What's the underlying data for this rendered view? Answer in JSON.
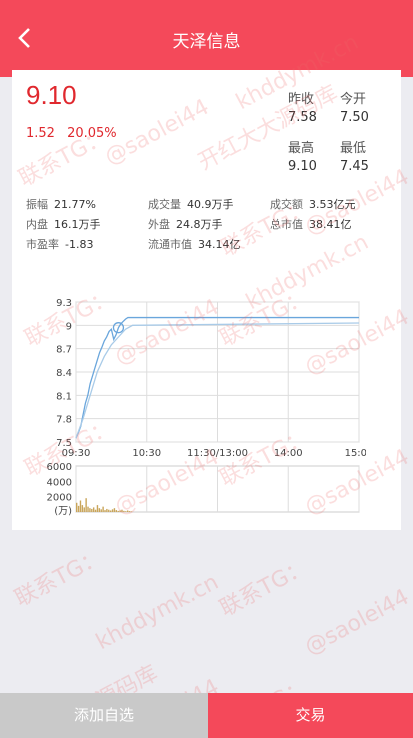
{
  "header": {
    "title": "天泽信息"
  },
  "quote": {
    "price": "9.10",
    "change": "1.52",
    "change_pct": "20.05%",
    "prev_close_label": "昨收",
    "prev_close": "7.58",
    "open_label": "今开",
    "open": "7.50",
    "high_label": "最高",
    "high": "9.10",
    "low_label": "最低",
    "low": "7.45"
  },
  "stats": [
    [
      {
        "label": "振幅",
        "value": "21.77%"
      },
      {
        "label": "成交量",
        "value": "40.9万手"
      },
      {
        "label": "成交额",
        "value": "3.53亿元"
      }
    ],
    [
      {
        "label": "内盘",
        "value": "16.1万手"
      },
      {
        "label": "外盘",
        "value": "24.8万手"
      },
      {
        "label": "总市值",
        "value": "38.41亿"
      }
    ],
    [
      {
        "label": "市盈率",
        "value": "-1.83"
      },
      {
        "label": "流通市值",
        "value": "34.14亿"
      }
    ]
  ],
  "chart_data": {
    "type": "line",
    "price_ticks": [
      "9.3",
      "9",
      "8.7",
      "8.4",
      "8.1",
      "7.8",
      "7.5"
    ],
    "price_ylim": [
      7.5,
      9.3
    ],
    "time_ticks": [
      "09:30",
      "10:30",
      "11:30/13:00",
      "14:00",
      "15:00"
    ],
    "series": [
      {
        "x": [
          0,
          2,
          4,
          6,
          8,
          10,
          12,
          14,
          16,
          18,
          20,
          22,
          24,
          26,
          28,
          30,
          32,
          34,
          36,
          38,
          40,
          42,
          44,
          46,
          48,
          240
        ],
        "values": [
          7.55,
          7.62,
          7.7,
          7.85,
          8.0,
          8.1,
          8.25,
          8.35,
          8.45,
          8.55,
          8.65,
          8.72,
          8.8,
          8.85,
          8.92,
          8.95,
          8.82,
          8.88,
          8.97,
          9.02,
          9.05,
          9.08,
          9.1,
          9.1,
          9.1,
          9.1
        ]
      },
      {
        "x": [
          0,
          6,
          12,
          18,
          24,
          30,
          36,
          42,
          48,
          240
        ],
        "values": [
          7.55,
          7.8,
          8.1,
          8.4,
          8.6,
          8.75,
          8.85,
          8.95,
          9.0,
          9.03
        ]
      }
    ],
    "volume_ticks": [
      "6000",
      "4000",
      "2000",
      "(万)"
    ],
    "volume_ylim": [
      0,
      6000
    ],
    "volume_bars": [
      1200,
      800,
      1500,
      900,
      600,
      1800,
      700,
      500,
      400,
      600,
      300,
      900,
      500,
      350,
      700,
      250,
      400,
      300,
      200,
      350,
      500,
      250,
      150,
      200,
      300,
      150,
      100,
      200,
      120,
      80
    ]
  },
  "watermarks": [
    "联系TG：",
    "@saolei44",
    "开红大大源码库",
    "khddymk.cn"
  ],
  "bottom": {
    "add_label": "添加自选",
    "trade_label": "交易"
  }
}
